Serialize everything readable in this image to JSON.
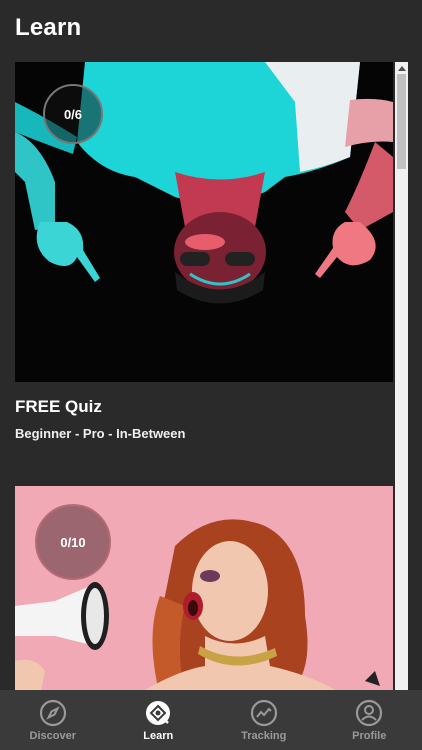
{
  "header": {
    "title": "Learn"
  },
  "cards": [
    {
      "badge": "0/6",
      "title": "FREE Quiz",
      "subtitle": "Beginner - Pro - In-Between"
    },
    {
      "badge": "0/10"
    }
  ],
  "tabs": [
    {
      "label": "Discover",
      "icon": "compass-icon",
      "active": false
    },
    {
      "label": "Learn",
      "icon": "learn-icon",
      "active": true
    },
    {
      "label": "Tracking",
      "icon": "chart-line-icon",
      "active": false
    },
    {
      "label": "Profile",
      "icon": "person-icon",
      "active": false
    }
  ],
  "colors": {
    "background": "#2a2a2a",
    "tabbar": "#3a3a3a",
    "active_tab": "#ffffff",
    "inactive_tab": "#9a9a9a"
  }
}
